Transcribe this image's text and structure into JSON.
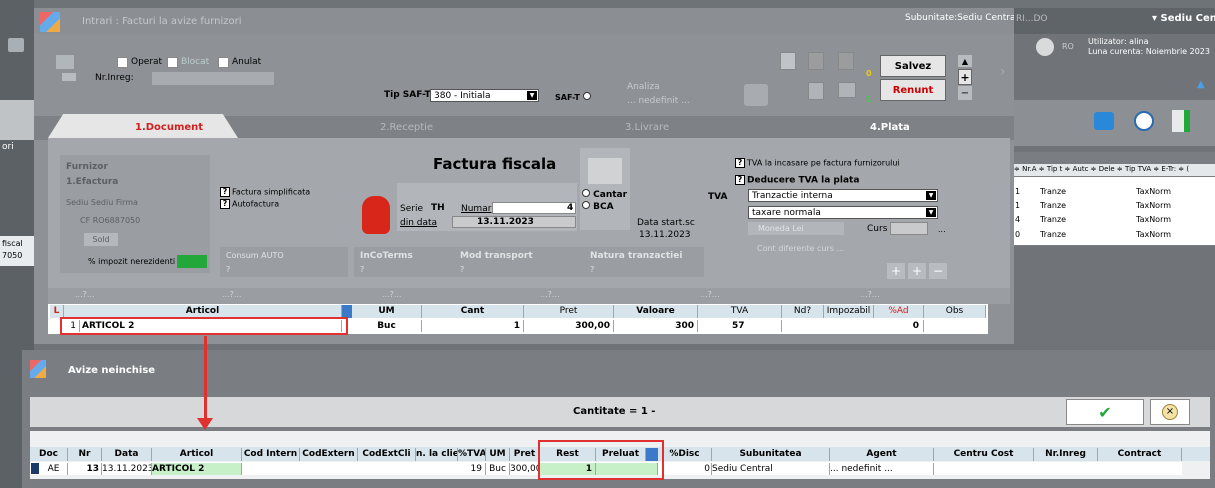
{
  "top": {
    "title": "Intrari : Facturi la avize furnizori",
    "subunit": "Subunitate:Sediu Central",
    "rido": "RI...DO",
    "sediu": "Sediu Centra",
    "lang": "RO",
    "user": "Utilizator: alina",
    "month": "Luna curenta: Noiembrie 2023"
  },
  "flags": {
    "operat": "Operat",
    "blocat": "Blocat",
    "anulat": "Anulat",
    "nr_inreg": "Nr.Inreg:",
    "tip_saf": "Tip SAF-T",
    "tip_saf_val": "380 - Initiala",
    "saft": "SAF-T",
    "analiza": "Analiza",
    "nedefinit": "... nedefinit ...",
    "zero": "0",
    "one": "1"
  },
  "actions": {
    "salvez": "Salvez",
    "salvez_hot": "z",
    "renunt": "Renunt",
    "renunt_hot": "R"
  },
  "tabs": [
    "1.Document",
    "2.Receptie",
    "3.Livrare",
    "4.Plata"
  ],
  "doc": {
    "furnizor_lbl": "Furnizor",
    "furnizor": "1.Efactura",
    "sediu": "Sediu  Sediu Firma",
    "cf": "CF  RO6887050",
    "sold": "Sold",
    "impozit": "% impozit nerezidenti",
    "fact_simpl": "Factura simplificata",
    "autofact": "Autofactura",
    "title": "Factura fiscala",
    "cantar": "Cantar",
    "bca": "BCA",
    "serie_lbl": "Serie",
    "serie": "TH",
    "numar_lbl": "Numar",
    "numar": "4",
    "din_data_lbl": "din data",
    "din_data": "13.11.2023",
    "data_start": "Data start.sc",
    "data_start_val": "13.11.2023",
    "consum": "Consum  AUTO",
    "q": "?",
    "incoterms": "InCoTerms",
    "mod_transport": "Mod transport",
    "natura": "Natura tranzactiei",
    "tva_incasare": "TVA la incasare pe factura furnizorului",
    "deducere": "Deducere TVA la plata",
    "tva": "TVA",
    "tranzactie": "Tranzactie interna",
    "taxare": "taxare normala",
    "moneda": "Moneda  Lei",
    "curs": "Curs",
    "ellipsis": "...",
    "cont_dif": "Cont diferente curs   ...",
    "placeholder": "...?..."
  },
  "grid": {
    "headers": [
      "L",
      "Articol",
      "UM",
      "Cant",
      "Pret",
      "Valoare",
      "TVA",
      "Nd?",
      "Impozabil",
      "%Ad",
      "Obs"
    ],
    "row": {
      "nr": "1",
      "articol": "ARTICOL 2",
      "um": "Buc",
      "cant": "1",
      "pret": "300,00",
      "valoare": "300",
      "tva": "57",
      "ad": "0"
    }
  },
  "right": {
    "ori": "ori",
    "fiscal": "fiscal",
    "num": "7050",
    "headers": "≑ Nr.A ≑ Tip t ≑ Autc ≑ Dele ≑ Tip TVA ≑ E-Tr: ≑ (",
    "rows": [
      [
        "1",
        "Tranze",
        "TaxNorm"
      ],
      [
        "1",
        "Tranze",
        "TaxNorm"
      ],
      [
        "4",
        "Tranze",
        "TaxNorm"
      ],
      [
        "0",
        "Tranze",
        "TaxNorm"
      ]
    ]
  },
  "avize": {
    "title": "Avize neinchise",
    "cantitate": "Cantitate = 1 -",
    "headers": [
      "Doc",
      "Nr",
      "Data",
      "Articol",
      "Cod Intern",
      "CodExtern",
      "CodExtCli",
      "n. la clie",
      "%TVA",
      "UM",
      "Pret",
      "Rest",
      "Preluat",
      "%Disc",
      "Subunitatea",
      "Agent",
      "Centru Cost",
      "Nr.Inreg",
      "Contract"
    ],
    "row": {
      "doc": "AE",
      "nr": "13",
      "data": "13.11.2023",
      "articol": "ARTICOL 2",
      "tva": "19",
      "um": "Buc",
      "pret": "300,00",
      "rest": "1",
      "disc": "0",
      "subunit": "Sediu Central",
      "agent": "... nedefinit ..."
    }
  },
  "colors": {
    "accent_red": "#e03030",
    "tab_bg": "#e6e6e6",
    "grid_header": "#d8e4ec",
    "green": "#22a83a"
  }
}
